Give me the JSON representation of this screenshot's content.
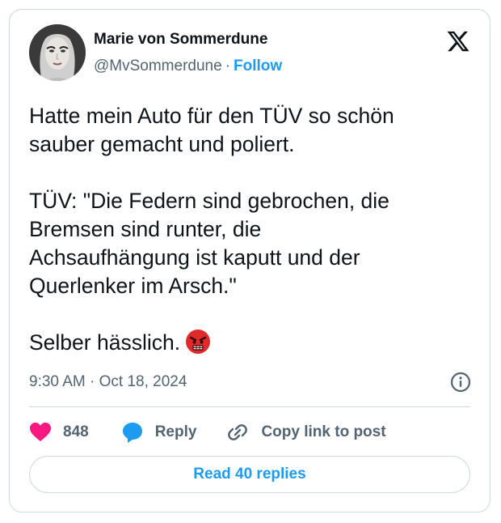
{
  "author": {
    "name": "Marie von Sommerdune",
    "handle": "@MvSommerdune",
    "separator": "·",
    "follow_label": "Follow"
  },
  "tweet": {
    "paragraphs": [
      [
        "Hatte mein Auto für den TÜV so schön",
        "sauber gemacht und poliert."
      ],
      [
        "TÜV: \"Die Federn sind gebrochen, die",
        "Bremsen sind runter, die",
        "Achsaufhängung ist kaputt und der",
        "Querlenker im Arsch.\""
      ],
      [
        "Selber hässlich."
      ]
    ],
    "emoji": "angry-face-emoji"
  },
  "meta": {
    "time": "9:30 AM",
    "separator": "·",
    "date": "Oct 18, 2024"
  },
  "actions": {
    "like_count": "848",
    "reply_label": "Reply",
    "copy_label": "Copy link to post"
  },
  "read_replies_label": "Read 40 replies",
  "icons": {
    "logo": "x-logo-icon",
    "info": "info-icon",
    "like": "heart-icon",
    "reply": "speech-bubble-icon",
    "copy": "link-icon"
  },
  "colors": {
    "accent": "#1d9bf0",
    "text": "#0f1419",
    "secondary": "#536471",
    "like": "#f91880",
    "border": "#cfd9de",
    "emoji": "#e0292b"
  }
}
